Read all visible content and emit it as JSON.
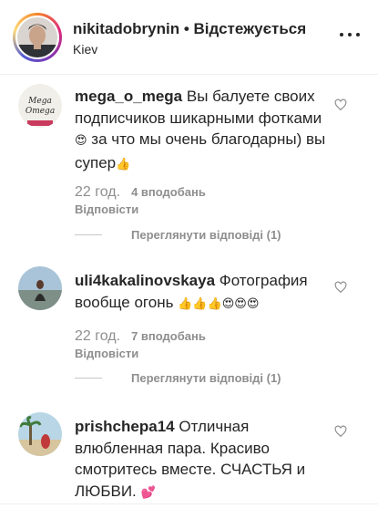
{
  "header": {
    "username": "nikitadobrynin",
    "separator": " • ",
    "follow_state": "Відстежується",
    "location": "Kiev"
  },
  "comments": [
    {
      "username": "mega_o_mega",
      "avatar_text": "Mega Omega",
      "text_1": "Вы балуете своих подписчиков шикарными фотками",
      "emoji_1": "😍",
      "text_2": " за что мы очень благодарны) вы супер",
      "emoji_2": "👍",
      "time": "22 год.",
      "likes": "4 вподобань",
      "reply": "Відповісти",
      "view_replies": "Переглянути відповіді (1)"
    },
    {
      "username": "uli4kakalinovskaya",
      "text_1": "Фотография вообще огонь",
      "emoji_2": "👍👍👍😍😍😍",
      "time": "22 год.",
      "likes": "7 вподобань",
      "reply": "Відповісти",
      "view_replies": "Переглянути відповіді (1)"
    },
    {
      "username": "prishchepa14",
      "text_1": "Отличная влюбленная пара. Красиво смотритесь вместе. СЧАСТЬЯ и ЛЮБВИ.",
      "emoji_2": "💕"
    }
  ],
  "colors": {
    "text": "#262626",
    "muted": "#8e8e8e",
    "divider": "#efefef",
    "heart_emoji": "#c0392b"
  },
  "icons": {
    "more": "more-horizontal-icon",
    "like": "heart-outline-icon"
  }
}
